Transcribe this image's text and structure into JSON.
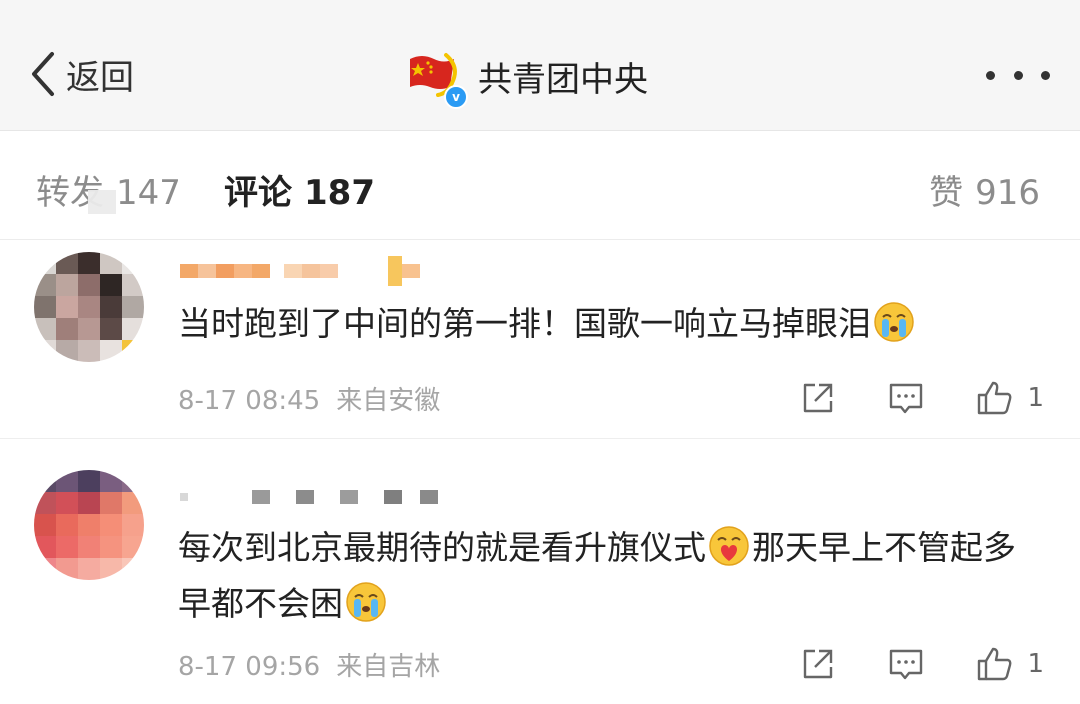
{
  "navbar": {
    "back_label": "返回",
    "title": "共青团中央",
    "verified_badge": "v"
  },
  "tabs": {
    "repost_label": "转发",
    "repost_count": "147",
    "comment_label": "评论",
    "comment_count": "187",
    "like_label": "赞",
    "like_count": "916"
  },
  "comments": [
    {
      "text_parts": [
        "当时跑到了中间的第一排！国歌一响立马掉眼泪",
        ""
      ],
      "time": "8-17 08:45",
      "location": "来自安徽",
      "likes": "1",
      "emoji": [
        "crying-emoji"
      ]
    },
    {
      "text_parts": [
        "每次到北京最期待的就是看升旗仪式",
        "那天早上不管起多早都不会困",
        ""
      ],
      "time": "8-17 09:56",
      "location": "来自吉林",
      "likes": "1",
      "emoji": [
        "heart-face-emoji",
        "crying-emoji"
      ]
    }
  ],
  "colors": {
    "accent_blue": "#2b9bf4",
    "flag_red": "#d7261e",
    "flag_gold": "#f4c400",
    "meta_gray": "#a5a5a5"
  },
  "icons": [
    "chevron-left-icon",
    "more-icon",
    "share-icon",
    "comment-icon",
    "thumbs-up-icon"
  ]
}
